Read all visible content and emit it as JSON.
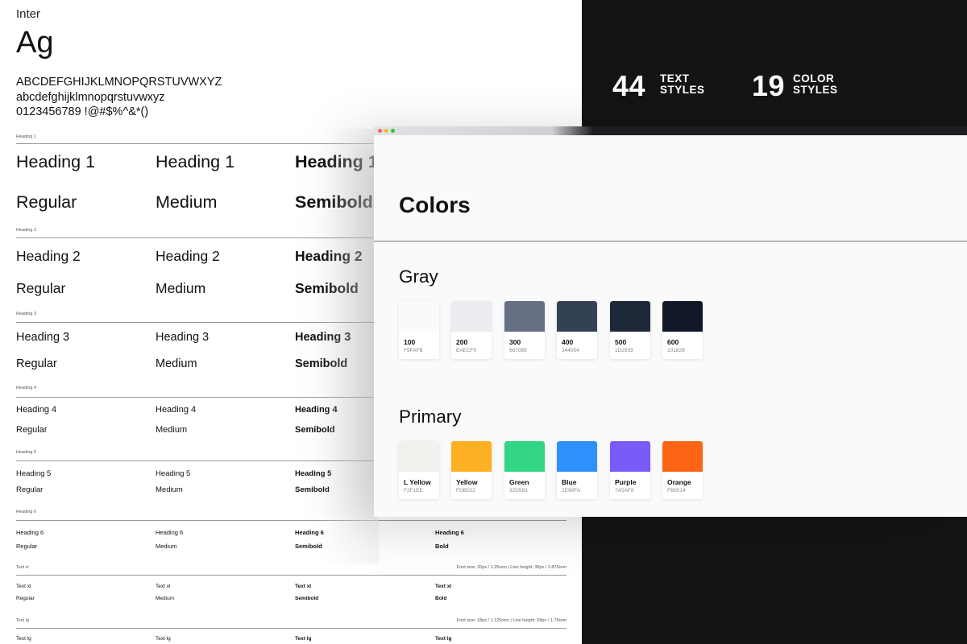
{
  "typography": {
    "font_name": "Inter",
    "specimen": "Ag",
    "uppercase": "ABCDEFGHIJKLMNOPQRSTUVWXYZ",
    "lowercase": "abcdefghijklmnopqrstuvwxyz",
    "digits": "0123456789 !@#$%^&*()",
    "sections": [
      {
        "label": "Heading 1",
        "meta": "",
        "sample": "Heading 1",
        "weights": [
          "Regular",
          "Medium",
          "Semibold"
        ]
      },
      {
        "label": "Heading 2",
        "meta": "",
        "sample": "Heading 2",
        "weights": [
          "Regular",
          "Medium",
          "Semibold"
        ]
      },
      {
        "label": "Heading 3",
        "meta": "",
        "sample": "Heading 3",
        "weights": [
          "Regular",
          "Medium",
          "Semibold"
        ]
      },
      {
        "label": "Heading 4",
        "meta": "",
        "sample": "Heading 4",
        "weights": [
          "Regular",
          "Medium",
          "Semibold"
        ]
      },
      {
        "label": "Heading 5",
        "meta": "",
        "sample": "Heading 5",
        "weights": [
          "Regular",
          "Medium",
          "Semibold"
        ]
      },
      {
        "label": "Heading 6",
        "meta": "",
        "sample": "Heading 6",
        "weights": [
          "Regular",
          "Medium",
          "Semibold",
          "Bold"
        ]
      },
      {
        "label": "Text xl",
        "meta": "Font size: 20px / 1.25rem | Line height: 30px / 1.875rem",
        "sample": "Text xl",
        "weights": [
          "Regular",
          "Medium",
          "Semibold",
          "Bold"
        ]
      },
      {
        "label": "Text lg",
        "meta": "Font size: 18px / 1.125rem | Line height: 28px / 1.75rem",
        "sample": "Text lg",
        "weights": []
      }
    ]
  },
  "stats": [
    {
      "number": "44",
      "line1": "TEXT",
      "line2": "STYLES"
    },
    {
      "number": "19",
      "line1": "COLOR",
      "line2": "STYLES"
    }
  ],
  "colors_window": {
    "title": "Colors",
    "groups": [
      {
        "name": "Gray",
        "swatches": [
          {
            "name": "100",
            "hex": "F9FAFB",
            "color": "#F9FAFB"
          },
          {
            "name": "200",
            "hex": "EAECF0",
            "color": "#EAECF0"
          },
          {
            "name": "300",
            "hex": "667085",
            "color": "#667085"
          },
          {
            "name": "400",
            "hex": "344054",
            "color": "#344054"
          },
          {
            "name": "500",
            "hex": "1D2939",
            "color": "#1D2939"
          },
          {
            "name": "600",
            "hex": "101828",
            "color": "#101828"
          }
        ]
      },
      {
        "name": "Primary",
        "swatches": [
          {
            "name": "L Yellow",
            "hex": "F2F1EE",
            "color": "#F2F1EE"
          },
          {
            "name": "Yellow",
            "hex": "FDB022",
            "color": "#FDB022"
          },
          {
            "name": "Green",
            "hex": "32D583",
            "color": "#32D583"
          },
          {
            "name": "Blue",
            "hex": "2E90FA",
            "color": "#2E90FA"
          },
          {
            "name": "Purple",
            "hex": "7A5AF8",
            "color": "#7A5AF8"
          },
          {
            "name": "Orange",
            "hex": "FB6514",
            "color": "#FB6514"
          }
        ]
      }
    ],
    "traffic_lights": [
      "#ff5f57",
      "#febc2e",
      "#28c840"
    ]
  }
}
